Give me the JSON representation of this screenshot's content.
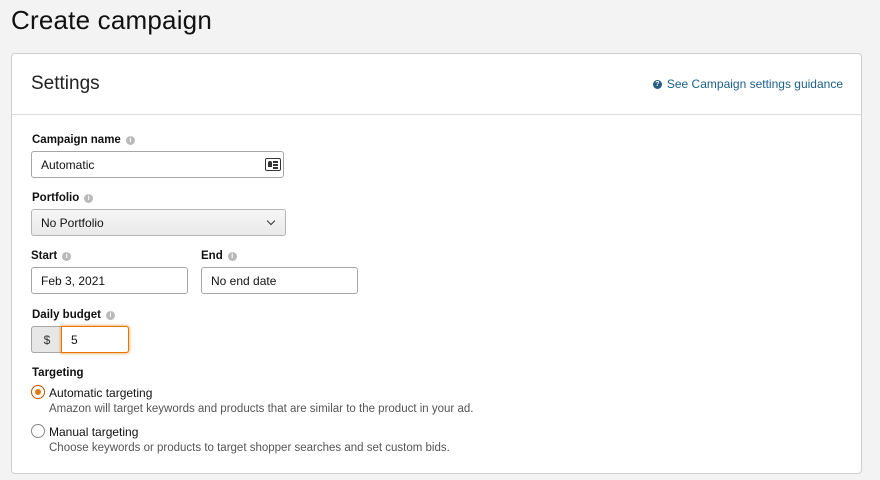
{
  "page": {
    "title": "Create campaign"
  },
  "settings": {
    "title": "Settings",
    "guidance_link": "See Campaign settings guidance",
    "campaign_name": {
      "label": "Campaign name",
      "value": "Automatic"
    },
    "portfolio": {
      "label": "Portfolio",
      "selected": "No Portfolio"
    },
    "start": {
      "label": "Start",
      "value": "Feb 3, 2021"
    },
    "end": {
      "label": "End",
      "value": "No end date"
    },
    "daily_budget": {
      "label": "Daily budget",
      "currency": "$",
      "value": "5"
    },
    "targeting": {
      "label": "Targeting",
      "options": [
        {
          "label": "Automatic targeting",
          "description": "Amazon will target keywords and products that are similar to the product in your ad.",
          "selected": true
        },
        {
          "label": "Manual targeting",
          "description": "Choose keywords or products to target shopper searches and set custom bids.",
          "selected": false
        }
      ]
    }
  },
  "icons": {
    "info": "info-icon",
    "help": "question-icon",
    "contact": "contact-card-icon",
    "dropdown": "chevron-down-icon"
  },
  "colors": {
    "link": "#1b5f8a",
    "focus": "#e77600",
    "radio_selected": "#e47911"
  }
}
